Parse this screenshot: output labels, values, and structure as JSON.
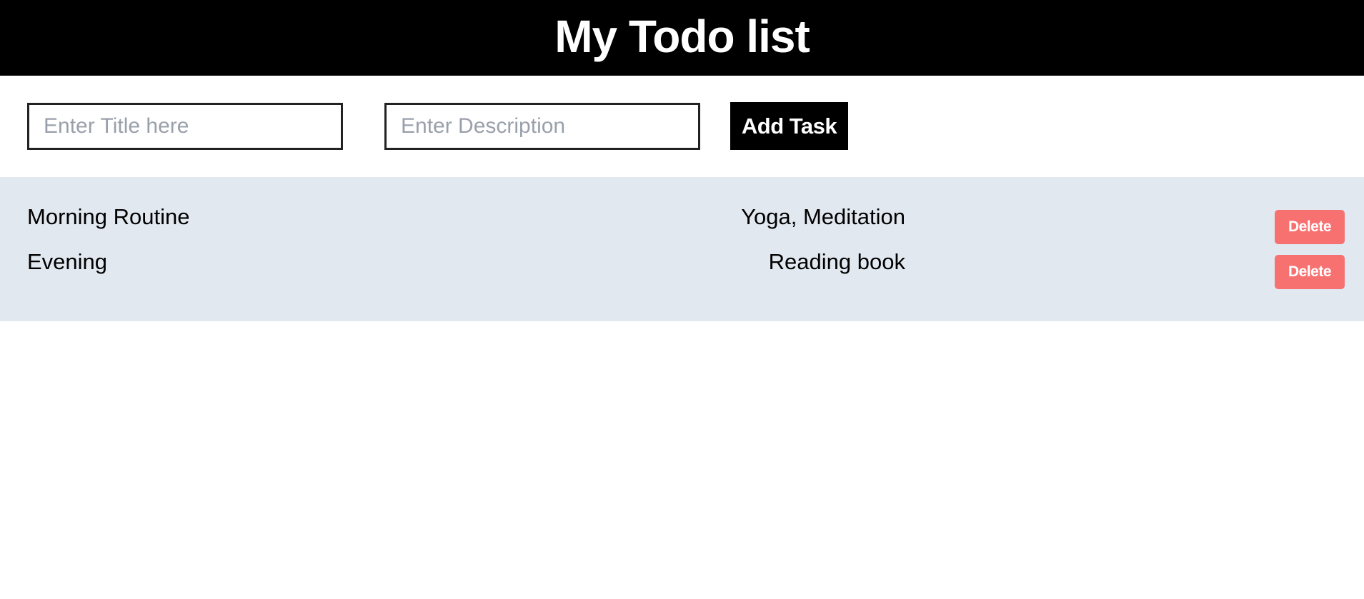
{
  "header": {
    "title": "My Todo list"
  },
  "form": {
    "title_placeholder": "Enter Title here",
    "title_value": "",
    "description_placeholder": "Enter Description",
    "description_value": "",
    "add_label": "Add Task"
  },
  "tasks": [
    {
      "title": "Morning Routine",
      "description": "Yoga, Meditation",
      "delete_label": "Delete"
    },
    {
      "title": "Evening",
      "description": "Reading book",
      "delete_label": "Delete"
    }
  ],
  "colors": {
    "header_bg": "#000000",
    "list_bg": "#e2e8f0",
    "delete_bg": "#f87171"
  }
}
